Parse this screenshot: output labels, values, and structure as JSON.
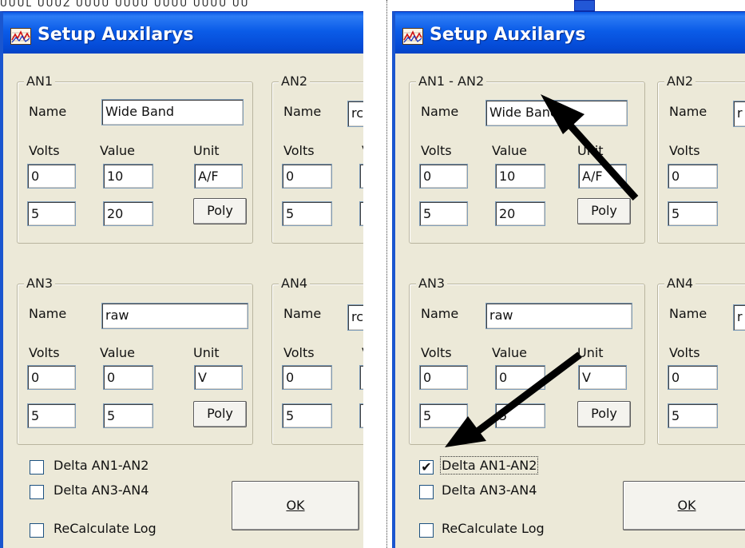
{
  "dialog": {
    "title": "Setup Auxilarys",
    "top_strip_text": "UUUL  UUUZ  UUUU  UUUU  UUUU  UUUU  UU"
  },
  "left": {
    "groups": {
      "an1": {
        "legend": "AN1",
        "name_label": "Name",
        "name_value": "Wide Band",
        "volts_label": "Volts",
        "value_label": "Value",
        "unit_label": "Unit",
        "volts": [
          "0",
          "5"
        ],
        "values": [
          "10",
          "20"
        ],
        "unit": "A/F",
        "poly_label": "Poly"
      },
      "an2": {
        "legend": "AN2",
        "name_label": "Name",
        "name_value": "rc",
        "volts_label": "Volts",
        "value_label": "V",
        "volts": [
          "0",
          "5"
        ]
      },
      "an3": {
        "legend": "AN3",
        "name_label": "Name",
        "name_value": "raw",
        "volts_label": "Volts",
        "value_label": "Value",
        "unit_label": "Unit",
        "volts": [
          "0",
          "5"
        ],
        "values": [
          "0",
          "5"
        ],
        "unit": "V",
        "poly_label": "Poly"
      },
      "an4": {
        "legend": "AN4",
        "name_label": "Name",
        "name_value": "rc",
        "volts_label": "Volts",
        "value_label": "V",
        "volts": [
          "0",
          "5"
        ]
      }
    },
    "checkboxes": [
      {
        "label": "Delta AN1-AN2",
        "checked": false
      },
      {
        "label": "Delta AN3-AN4",
        "checked": false
      },
      {
        "label": "ReCalculate Log",
        "checked": false
      }
    ],
    "ok_label": "OK"
  },
  "right": {
    "groups": {
      "an1": {
        "legend": "AN1 - AN2",
        "name_label": "Name",
        "name_value": "Wide Band",
        "volts_label": "Volts",
        "value_label": "Value",
        "unit_label": "Unit",
        "volts": [
          "0",
          "5"
        ],
        "values": [
          "10",
          "20"
        ],
        "unit": "A/F",
        "poly_label": "Poly"
      },
      "an2": {
        "legend": "AN2",
        "name_label": "Name",
        "name_value": "r",
        "volts_label": "Volts",
        "volts": [
          "0",
          "5"
        ]
      },
      "an3": {
        "legend": "AN3",
        "name_label": "Name",
        "name_value": "raw",
        "volts_label": "Volts",
        "value_label": "Value",
        "unit_label": "Unit",
        "volts": [
          "0",
          "5"
        ],
        "values": [
          "0",
          "5"
        ],
        "unit": "V",
        "poly_label": "Poly"
      },
      "an4": {
        "legend": "AN4",
        "name_label": "Name",
        "name_value": "r",
        "volts_label": "Volts",
        "volts": [
          "0",
          "5"
        ]
      }
    },
    "checkboxes": [
      {
        "label": "Delta AN1-AN2",
        "checked": true,
        "mark": "✔"
      },
      {
        "label": "Delta AN3-AN4",
        "checked": false
      },
      {
        "label": "ReCalculate Log",
        "checked": false
      }
    ],
    "ok_label": "OK"
  },
  "colors": {
    "titlebar": "#0b5ce8",
    "dialog_bg": "#ece9d8",
    "field_border": "#7f9db9",
    "arrow": "#000000"
  }
}
